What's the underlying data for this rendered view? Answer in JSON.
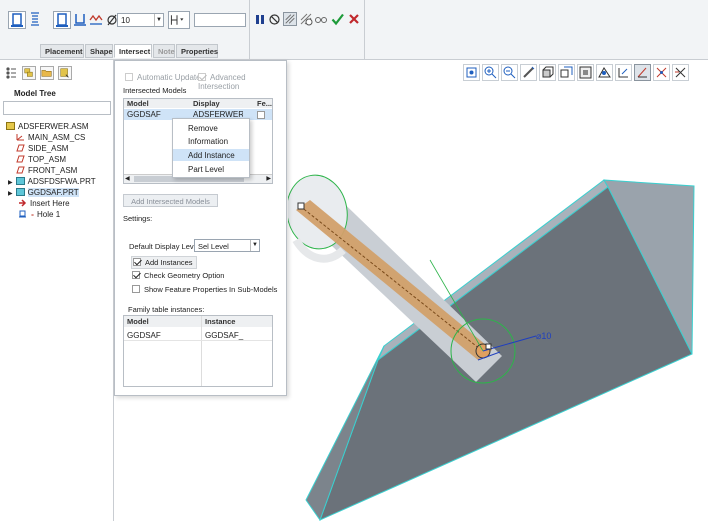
{
  "toolbar": {
    "depth_value": "10",
    "icons": [
      "hole-straight-icon",
      "hole-sketched-icon",
      "hole-standard-icon",
      "hole-profile-icon",
      "hole-counterbore-icon",
      "diameter-icon",
      "depth-option-icon",
      "pause-icon",
      "stop-icon",
      "preview-icon",
      "verify-icon",
      "glasses-icon",
      "confirm-icon",
      "cancel-icon"
    ]
  },
  "tabs": [
    "Placement",
    "Shape",
    "Intersect",
    "Note",
    "Properties"
  ],
  "active_tab": "Intersect",
  "model_tree": {
    "title": "Model Tree",
    "items": [
      "ADSFERWER.ASM",
      "MAIN_ASM_CS",
      "SIDE_ASM",
      "TOP_ASM",
      "FRONT_ASM",
      "ADSFDSFWA.PRT",
      "GGDSAF.PRT",
      "Insert Here",
      "Hole 1"
    ]
  },
  "intersect": {
    "auto_update": "Automatic Update",
    "advanced": "Advanced Intersection",
    "intersected_models": "Intersected Models",
    "columns": [
      "Model",
      "Display",
      "Fe..."
    ],
    "row": {
      "model": "GGDSAF",
      "display": "ADSFERWER.ASM"
    },
    "context_menu": [
      "Remove",
      "Information",
      "Add Instance",
      "Part Level"
    ],
    "highlighted_menu": "Add Instance",
    "add_button": "Add Intersected Models",
    "settings": "Settings:",
    "display_level_label": "Default Display Level",
    "display_level_value": "Sel Level",
    "add_instances": "Add Instances",
    "check_geometry": "Check Geometry Option",
    "show_props": "Show Feature Properties In Sub-Models",
    "family_label": "Family table instances:",
    "family_columns": [
      "Model",
      "Instance"
    ],
    "family_row": {
      "model": "GGDSAF",
      "instance": "GGDSAF_"
    }
  },
  "viewport": {
    "dimension": "⌀10",
    "icons": [
      "refit-icon",
      "zoom-in-icon",
      "zoom-out-icon",
      "repaint-icon",
      "display-style-icon",
      "saved-views-icon",
      "view-manager-icon",
      "perspective-icon",
      "datum-display-icon",
      "annotation-icon",
      "spin-center-icon",
      "datum-planes-icon"
    ]
  },
  "colors": {
    "accent": "#1f5fbf",
    "selection": "#cfe3f7",
    "block": "#6b727a",
    "block_top": "#a9b2bb",
    "edge": "#3ad0d0",
    "cylinder": "#c9ced4",
    "hole": "#d2a06a"
  }
}
